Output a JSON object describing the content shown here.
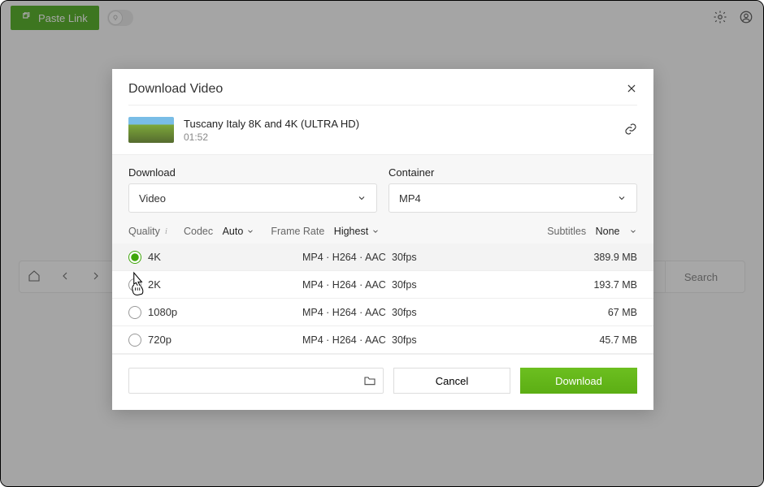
{
  "toolbar": {
    "paste_link": "Paste Link",
    "search": "Search"
  },
  "modal": {
    "title": "Download Video",
    "video_title": "Tuscany Italy 8K and 4K (ULTRA HD)",
    "duration": "01:52",
    "download_label": "Download",
    "container_label": "Container",
    "download_value": "Video",
    "container_value": "MP4",
    "quality_label": "Quality",
    "codec_label": "Codec",
    "codec_value": "Auto",
    "framerate_label": "Frame Rate",
    "framerate_value": "Highest",
    "subtitles_label": "Subtitles",
    "subtitles_value": "None",
    "cancel": "Cancel",
    "download_btn": "Download"
  },
  "quality_options": [
    {
      "label": "4K",
      "format": "MP4 · H264 · AAC",
      "fps": "30fps",
      "size": "389.9 MB",
      "selected": true
    },
    {
      "label": "2K",
      "format": "MP4 · H264 · AAC",
      "fps": "30fps",
      "size": "193.7 MB",
      "selected": false
    },
    {
      "label": "1080p",
      "format": "MP4 · H264 · AAC",
      "fps": "30fps",
      "size": "67 MB",
      "selected": false
    },
    {
      "label": "720p",
      "format": "MP4 · H264 · AAC",
      "fps": "30fps",
      "size": "45.7 MB",
      "selected": false
    }
  ]
}
